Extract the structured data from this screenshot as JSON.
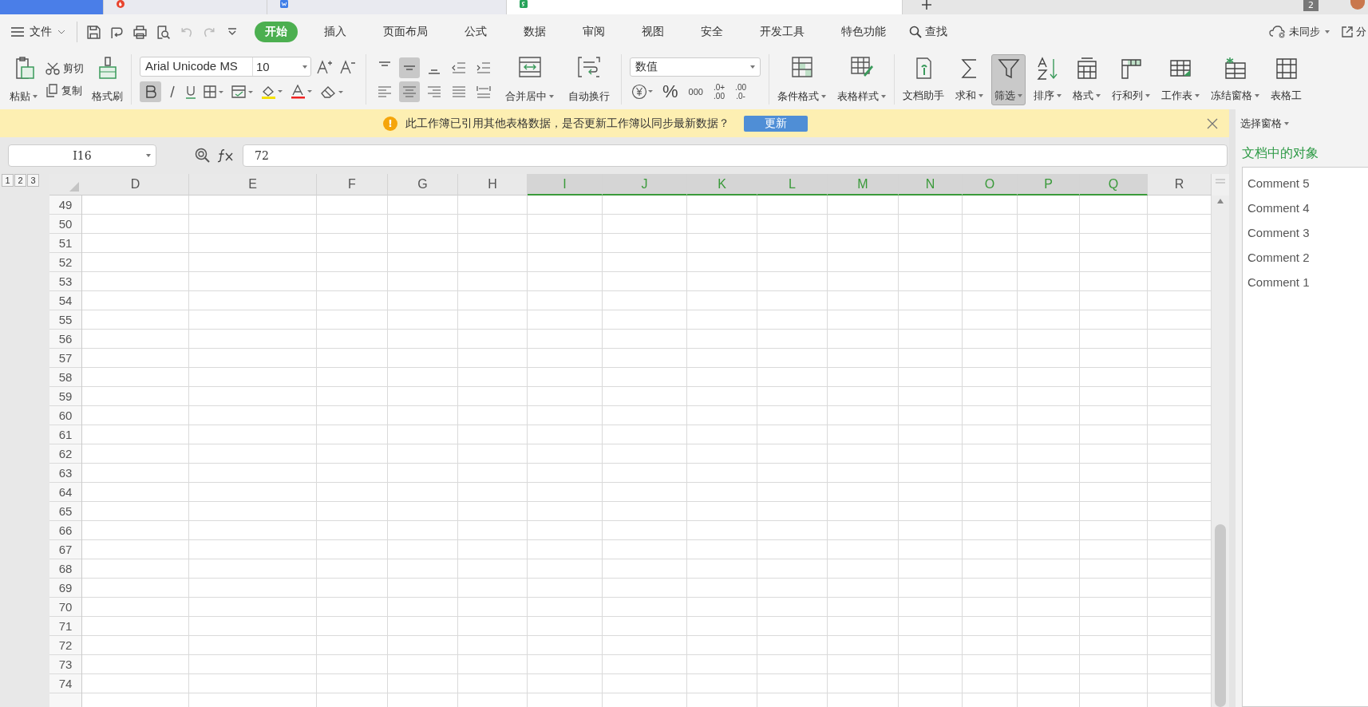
{
  "doc_tabs": [
    {
      "kind": "home",
      "selected": false
    },
    {
      "kind": "template",
      "selected": false
    },
    {
      "kind": "word",
      "selected": false
    },
    {
      "kind": "sheet",
      "selected": true
    }
  ],
  "window_count": "2",
  "menu": {
    "file": "文件",
    "tabs": [
      {
        "label": "开始",
        "selected": true
      },
      {
        "label": "插入",
        "selected": false
      },
      {
        "label": "页面布局",
        "selected": false
      },
      {
        "label": "公式",
        "selected": false
      },
      {
        "label": "数据",
        "selected": false
      },
      {
        "label": "审阅",
        "selected": false
      },
      {
        "label": "视图",
        "selected": false
      },
      {
        "label": "安全",
        "selected": false
      },
      {
        "label": "开发工具",
        "selected": false
      },
      {
        "label": "特色功能",
        "selected": false
      }
    ],
    "search": "查找",
    "sync": "未同步",
    "share": "分"
  },
  "clipboard": {
    "paste": "粘贴",
    "cut": "剪切",
    "copy": "复制",
    "format_painter": "格式刷"
  },
  "font": {
    "name": "Arial Unicode MS",
    "size": "10",
    "bold": true
  },
  "align": {
    "vertical": [
      {
        "kind": "top",
        "selected": false
      },
      {
        "kind": "middle",
        "selected": true
      },
      {
        "kind": "bottom",
        "selected": false
      },
      {
        "kind": "outdent",
        "selected": false
      },
      {
        "kind": "indent",
        "selected": false
      }
    ],
    "horizontal": [
      {
        "kind": "left",
        "selected": false
      },
      {
        "kind": "center",
        "selected": true
      },
      {
        "kind": "right",
        "selected": false
      },
      {
        "kind": "justify",
        "selected": false
      },
      {
        "kind": "distribute",
        "selected": false
      }
    ],
    "merge": "合并居中",
    "wrap": "自动换行"
  },
  "number": {
    "format": "数值",
    "percent": "%",
    "thousands": "000",
    "inc_decimal": [
      ".0+",
      ".00"
    ],
    "dec_decimal": [
      ".00",
      ".0-"
    ]
  },
  "styles": {
    "conditional": "条件格式",
    "table_style": "表格样式"
  },
  "tools": [
    {
      "label": "文档助手",
      "kind": "assistant",
      "has_menu": false,
      "selected": false
    },
    {
      "label": "求和",
      "kind": "sum",
      "has_menu": true,
      "selected": false
    },
    {
      "label": "筛选",
      "kind": "filter",
      "has_menu": true,
      "selected": true
    },
    {
      "label": "排序",
      "kind": "sort",
      "has_menu": true,
      "selected": false
    },
    {
      "label": "格式",
      "kind": "format",
      "has_menu": true,
      "selected": false
    },
    {
      "label": "行和列",
      "kind": "rowcol",
      "has_menu": true,
      "selected": false
    },
    {
      "label": "工作表",
      "kind": "worksheet",
      "has_menu": true,
      "selected": false
    },
    {
      "label": "冻结窗格",
      "kind": "freeze",
      "has_menu": true,
      "selected": false
    },
    {
      "label": "表格工",
      "kind": "table",
      "has_menu": false,
      "selected": false
    }
  ],
  "notice": {
    "icon": "!",
    "text": "此工作簿已引用其他表格数据，是否更新工作簿以同步最新数据？",
    "button": "更新"
  },
  "formula": {
    "cell": "I16",
    "value": "72"
  },
  "outline_levels": [
    "1",
    "2",
    "3"
  ],
  "columns": [
    {
      "label": "D",
      "selected": false
    },
    {
      "label": "E",
      "selected": false
    },
    {
      "label": "F",
      "selected": false
    },
    {
      "label": "G",
      "selected": false
    },
    {
      "label": "H",
      "selected": false
    },
    {
      "label": "I",
      "selected": true
    },
    {
      "label": "J",
      "selected": true
    },
    {
      "label": "K",
      "selected": true
    },
    {
      "label": "L",
      "selected": true
    },
    {
      "label": "M",
      "selected": true
    },
    {
      "label": "N",
      "selected": true
    },
    {
      "label": "O",
      "selected": true
    },
    {
      "label": "P",
      "selected": true
    },
    {
      "label": "Q",
      "selected": true
    },
    {
      "label": "R",
      "selected": false
    }
  ],
  "rows": [
    "49",
    "50",
    "51",
    "52",
    "53",
    "54",
    "55",
    "56",
    "57",
    "58",
    "59",
    "60",
    "61",
    "62",
    "63",
    "64",
    "65",
    "66",
    "67",
    "68",
    "69",
    "70",
    "71",
    "72",
    "73",
    "74"
  ],
  "pane": {
    "title": "选择窗格",
    "heading": "文档中的对象",
    "items": [
      "Comment 5",
      "Comment 4",
      "Comment 3",
      "Comment 2",
      "Comment 1"
    ]
  }
}
